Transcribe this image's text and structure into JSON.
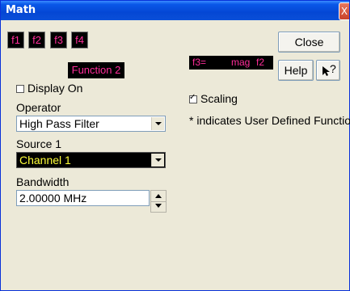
{
  "window": {
    "title": "Math",
    "close_glyph": "X"
  },
  "function_buttons": [
    "f1",
    "f2",
    "f3",
    "f4"
  ],
  "function_header": "Function 2",
  "expression": {
    "lhs": "f3=",
    "op": "mag",
    "arg": "f2"
  },
  "buttons": {
    "close": "Close",
    "help": "Help",
    "whats_this": "?"
  },
  "display_on": {
    "label": "Display On",
    "checked": false
  },
  "operator": {
    "label": "Operator",
    "value": "High Pass Filter"
  },
  "source1": {
    "label": "Source 1",
    "value": "Channel 1"
  },
  "bandwidth": {
    "label": "Bandwidth",
    "value": "2.00000 MHz"
  },
  "scaling": {
    "label": "Scaling",
    "checked": true
  },
  "note": "* indicates User Defined Function",
  "colors": {
    "title_bar": "#0a58e8",
    "function_text": "#ff2d9a",
    "source_text": "#ffff3a"
  }
}
